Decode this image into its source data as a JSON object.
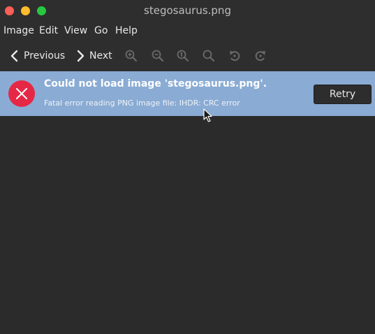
{
  "window": {
    "title": "stegosaurus.png"
  },
  "menubar": {
    "items": [
      "Image",
      "Edit",
      "View",
      "Go",
      "Help"
    ]
  },
  "toolbar": {
    "previous_label": "Previous",
    "next_label": "Next",
    "icons": [
      "zoom-in-icon",
      "zoom-out-icon",
      "zoom-normal-icon",
      "zoom-fit-icon",
      "rotate-left-icon",
      "rotate-right-icon"
    ]
  },
  "infobar": {
    "title": "Could not load image 'stegosaurus.png'.",
    "detail": "Fatal error reading PNG image file: IHDR: CRC error",
    "retry_label": "Retry",
    "background": "#8aabd3",
    "error_color": "#e52846"
  }
}
